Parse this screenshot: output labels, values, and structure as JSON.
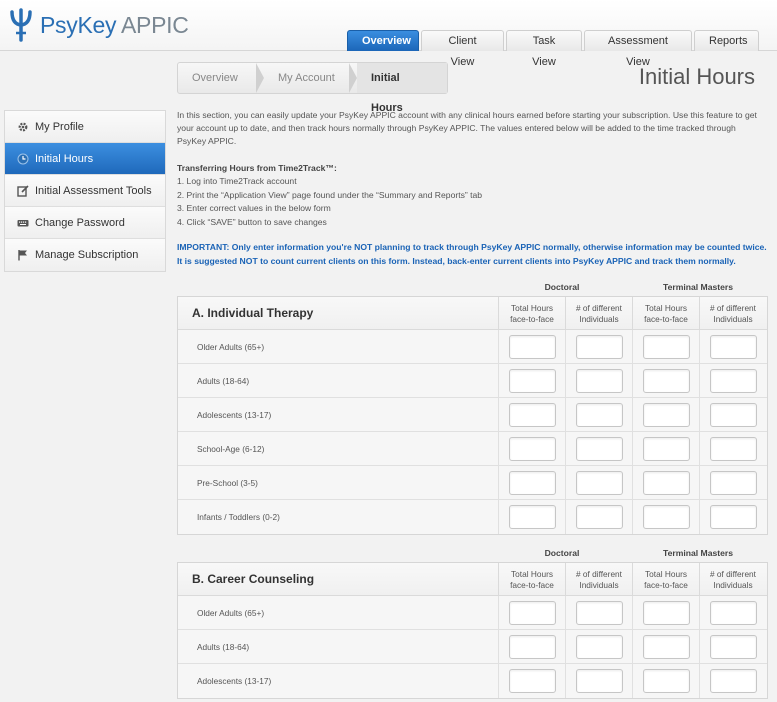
{
  "brand": {
    "name": "PsyKey",
    "suffix": "APPIC",
    "color": "#2a6fb4"
  },
  "tabs": [
    {
      "label": "Overview",
      "active": true
    },
    {
      "label": "Client View",
      "active": false
    },
    {
      "label": "Task View",
      "active": false
    },
    {
      "label": "Assessment View",
      "active": false
    },
    {
      "label": "Reports",
      "active": false
    }
  ],
  "breadcrumb": [
    "Overview",
    "My Account",
    "Initial Hours"
  ],
  "page_title": "Initial Hours",
  "sidebar": {
    "items": [
      {
        "label": "My Profile",
        "icon": "gear-icon",
        "active": false
      },
      {
        "label": "Initial Hours",
        "icon": "clock-icon",
        "active": true
      },
      {
        "label": "Initial Assessment Tools",
        "icon": "edit-icon",
        "active": false
      },
      {
        "label": "Change Password",
        "icon": "keyboard-icon",
        "active": false
      },
      {
        "label": "Manage Subscription",
        "icon": "flag-icon",
        "active": false
      }
    ]
  },
  "intro": "In this section, you can easily update your PsyKey APPIC account with any clinical hours earned before starting your subscription. Use this feature to get your account up to date, and then track hours normally through PsyKey APPIC. The values entered below will be added to the time tracked through PsyKey APPIC.",
  "transfer": {
    "title": "Transferring Hours from Time2Track™:",
    "steps": [
      "1.  Log into Time2Track account",
      "2.  Print the “Application View” page found under the “Summary and Reports” tab",
      "3.  Enter correct values in the below form",
      "4.  Click “SAVE” button to save changes"
    ]
  },
  "important": "IMPORTANT: Only enter information you're NOT planning to track through PsyKey APPIC normally, otherwise information may be counted twice. It is suggested NOT to count current clients on this form. Instead, back-enter current clients into PsyKey APPIC and track them normally.",
  "groups": {
    "doctoral": "Doctoral",
    "terminal": "Terminal Masters"
  },
  "columns": {
    "total_line1": "Total Hours",
    "total_line2": "face-to-face",
    "indiv_line1": "# of different",
    "indiv_line2": "Individuals"
  },
  "sections": [
    {
      "title": "A. Individual Therapy",
      "rows": [
        "Older Adults (65+)",
        "Adults (18-64)",
        "Adolescents (13-17)",
        "School-Age (6-12)",
        "Pre-School (3-5)",
        "Infants / Toddlers (0-2)"
      ]
    },
    {
      "title": "B. Career Counseling",
      "rows": [
        "Older Adults (65+)",
        "Adults (18-64)",
        "Adolescents (13-17)"
      ]
    }
  ]
}
